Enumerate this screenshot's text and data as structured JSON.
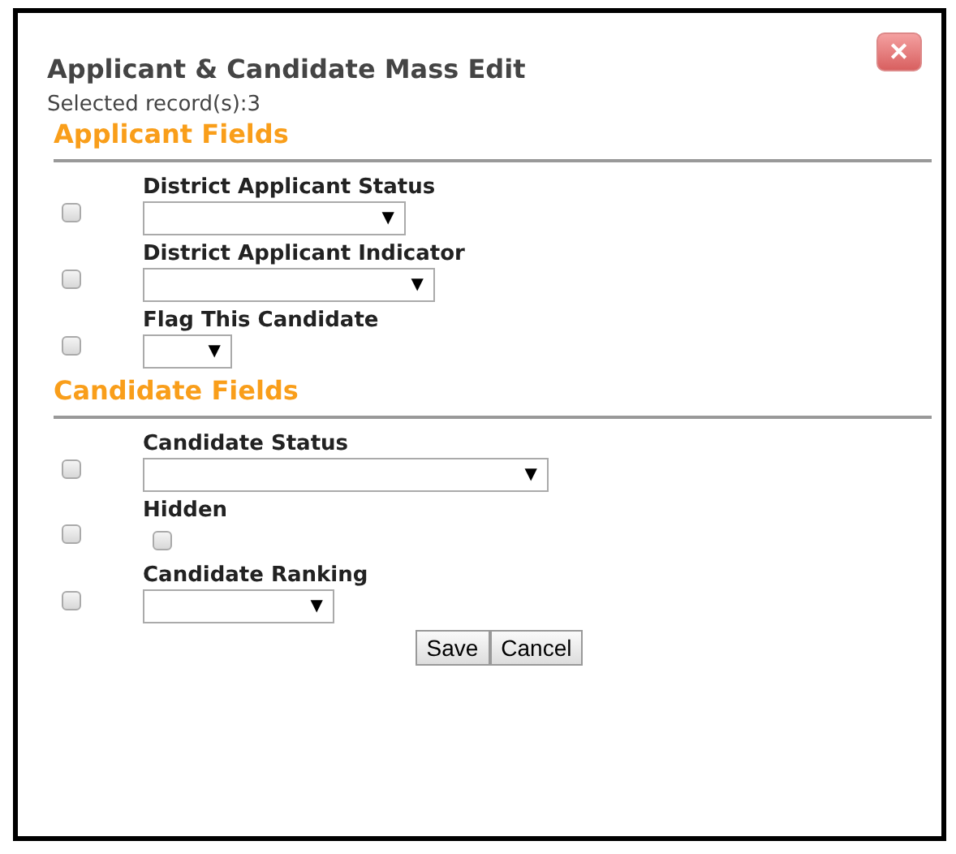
{
  "dialog": {
    "title": "Applicant & Candidate Mass Edit",
    "subtitle": "Selected record(s):3",
    "close_icon": "✕",
    "sections": [
      {
        "heading": "Applicant Fields",
        "fields": [
          {
            "label": "District Applicant Status",
            "kind": "select",
            "checked": false,
            "arrow": "▼"
          },
          {
            "label": "District Applicant Indicator",
            "kind": "select",
            "checked": false,
            "arrow": "▼"
          },
          {
            "label": "Flag This Candidate",
            "kind": "select",
            "checked": false,
            "arrow": "▼"
          }
        ]
      },
      {
        "heading": "Candidate Fields",
        "fields": [
          {
            "label": "Candidate Status",
            "kind": "select",
            "checked": false,
            "arrow": "▼"
          },
          {
            "label": "Hidden",
            "kind": "checkbox",
            "checked": false,
            "value_checked": false
          },
          {
            "label": "Candidate Ranking",
            "kind": "select",
            "checked": false,
            "arrow": "▼"
          }
        ]
      }
    ],
    "buttons": [
      "Save",
      "Cancel"
    ]
  }
}
